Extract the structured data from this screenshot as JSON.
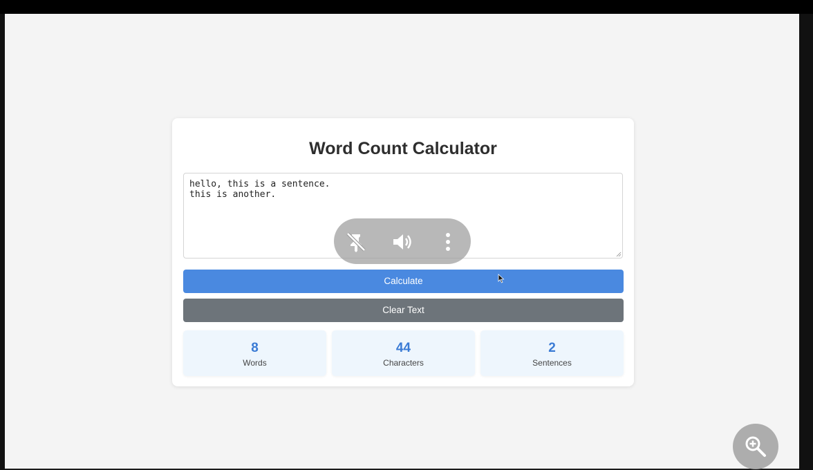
{
  "app": {
    "title": "Word Count Calculator"
  },
  "editor": {
    "lines": [
      "hello, this is a sentence.",
      "this is another."
    ]
  },
  "buttons": {
    "calculate_label": "Calculate",
    "clear_label": "Clear Text"
  },
  "stats": [
    {
      "value": "8",
      "label": "Words"
    },
    {
      "value": "44",
      "label": "Characters"
    },
    {
      "value": "2",
      "label": "Sentences"
    }
  ],
  "overlay": {
    "icons": [
      "unpin-icon",
      "volume-icon",
      "more-vertical-icon"
    ]
  },
  "floating": {
    "icon": "zoom-in-icon"
  },
  "colors": {
    "primary": "#4a89e0",
    "secondary": "#6d747a",
    "stat_value": "#3a7bd5",
    "stat_bg": "#eef6fd"
  }
}
